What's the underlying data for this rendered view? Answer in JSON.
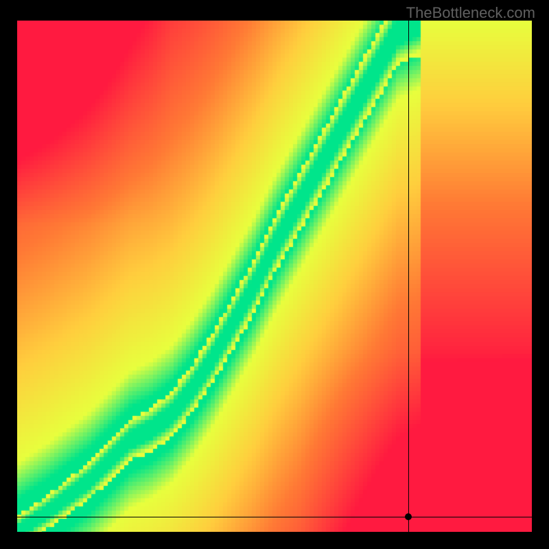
{
  "watermark": "TheBottleneck.com",
  "chart_data": {
    "type": "heatmap",
    "title": "",
    "xlabel": "",
    "ylabel": "",
    "xlim": [
      0,
      100
    ],
    "ylim": [
      0,
      100
    ],
    "colormap": {
      "best": "#00e58b",
      "good": "#e8ff3d",
      "mid": "#ffcf3e",
      "poor": "#ff7a35",
      "worst": "#ff1a40"
    },
    "ideal_curve_xy": [
      [
        0,
        0
      ],
      [
        3,
        2
      ],
      [
        6,
        4
      ],
      [
        10,
        7
      ],
      [
        14,
        10
      ],
      [
        18,
        14
      ],
      [
        22,
        18
      ],
      [
        26,
        20
      ],
      [
        30,
        23
      ],
      [
        34,
        28
      ],
      [
        38,
        34
      ],
      [
        42,
        41
      ],
      [
        46,
        48
      ],
      [
        50,
        56
      ],
      [
        54,
        63
      ],
      [
        58,
        70
      ],
      [
        62,
        77
      ],
      [
        66,
        84
      ],
      [
        70,
        91
      ],
      [
        74,
        98
      ],
      [
        78,
        100
      ]
    ],
    "marker": {
      "x": 76,
      "y": 3
    },
    "crosshair": {
      "x": 76,
      "y": 3
    },
    "description": "Color field showing match quality. Green ridge follows an S-curve from bottom-left toward top; red in opposite corners; yellow/orange transition between. Crosshair and dot mark a point far below the ridge in the lower-right region."
  }
}
